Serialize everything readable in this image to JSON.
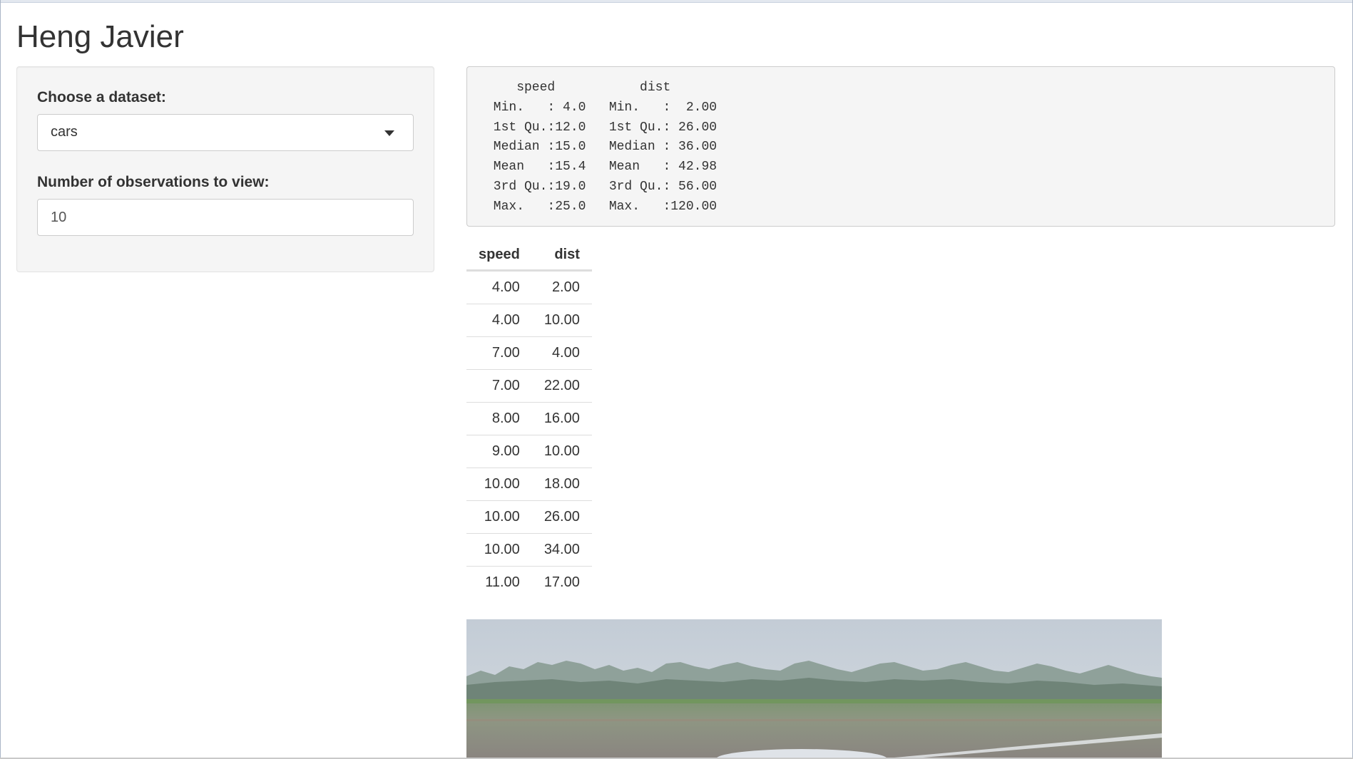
{
  "page": {
    "title": "Heng Javier"
  },
  "sidebar": {
    "dataset_label": "Choose a dataset:",
    "dataset_selected": "cars",
    "obs_label": "Number of observations to view:",
    "obs_value": "10"
  },
  "summary": {
    "text": "    speed           dist       \n Min.   : 4.0   Min.   :  2.00  \n 1st Qu.:12.0   1st Qu.: 26.00  \n Median :15.0   Median : 36.00  \n Mean   :15.4   Mean   : 42.98  \n 3rd Qu.:19.0   3rd Qu.: 56.00  \n Max.   :25.0   Max.   :120.00  "
  },
  "table": {
    "headers": [
      "speed",
      "dist"
    ],
    "rows": [
      [
        "4.00",
        "2.00"
      ],
      [
        "4.00",
        "10.00"
      ],
      [
        "7.00",
        "4.00"
      ],
      [
        "7.00",
        "22.00"
      ],
      [
        "8.00",
        "16.00"
      ],
      [
        "9.00",
        "10.00"
      ],
      [
        "10.00",
        "18.00"
      ],
      [
        "10.00",
        "26.00"
      ],
      [
        "10.00",
        "34.00"
      ],
      [
        "11.00",
        "17.00"
      ]
    ]
  },
  "image": {
    "icon": "landscape-photo"
  }
}
